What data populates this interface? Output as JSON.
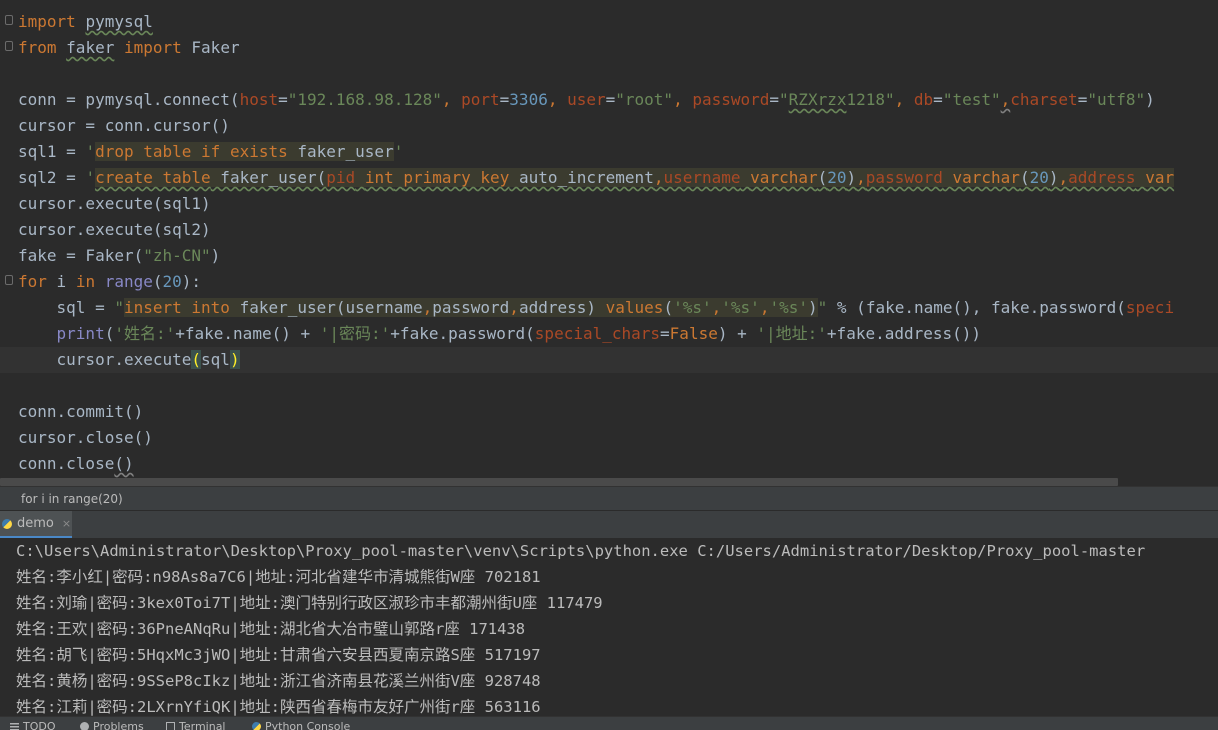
{
  "editor": {
    "lines": [
      [
        "import",
        " ",
        "pymysql"
      ],
      [
        "from",
        " ",
        "faker",
        " ",
        "import",
        " Faker"
      ],
      [
        ""
      ],
      [
        "conn = pymysql.connect(",
        "host",
        "=",
        "\"192.168.98.128\"",
        ", ",
        "port",
        "=",
        "3306",
        ", ",
        "user",
        "=",
        "\"root\"",
        ", ",
        "password",
        "=",
        "\"",
        "RZXrzx",
        "1218\"",
        ", ",
        "db",
        "=",
        "\"test\"",
        ",",
        "charset",
        "=",
        "\"utf8\"",
        ")"
      ],
      [
        "cursor = conn.cursor()"
      ],
      [
        "sql1 = ",
        "'",
        "drop table if exists",
        " faker_user",
        "'"
      ],
      [
        "sql2 = ",
        "'",
        "create table",
        " faker_user(",
        "pid",
        " ",
        "int",
        " ",
        "primary key",
        " auto_increment",
        ",",
        "username",
        " ",
        "varchar",
        "(",
        "20",
        ")",
        ",",
        "password",
        " ",
        "varchar",
        "(",
        "20",
        ")",
        ",",
        "address",
        " ",
        "var"
      ],
      [
        "cursor.execute(sql1)"
      ],
      [
        "cursor.execute(sql2)"
      ],
      [
        "fake = Faker(",
        "\"zh-CN\"",
        ")"
      ],
      [
        "for",
        " i ",
        "in",
        " ",
        "range",
        "(",
        "20",
        "):"
      ],
      [
        "    sql = ",
        "\"",
        "insert into",
        " faker_user(username",
        ",",
        "password",
        ",",
        "address) ",
        "values",
        "(",
        "'",
        "%s",
        "'",
        ",",
        "'",
        "%s",
        "'",
        ",",
        "'",
        "%s",
        "'",
        ")",
        "\"",
        " % (fake.name(), fake.password(",
        "speci"
      ],
      [
        "    ",
        "print",
        "(",
        "'姓名:'",
        "+fake.name() + ",
        "'|密码:'",
        "+fake.password(",
        "special_chars",
        "=",
        "False",
        ") + ",
        "'|地址:'",
        "+fake.address())"
      ],
      [
        "    cursor.execute",
        "(",
        "sql",
        ")"
      ],
      [
        ""
      ],
      [
        "conn.commit()"
      ],
      [
        "cursor.close()"
      ],
      [
        "conn.close",
        "()"
      ]
    ]
  },
  "breadcrumb": {
    "text": "for i in range(20)"
  },
  "run": {
    "tab_label": "demo",
    "close_glyph": "×"
  },
  "console": {
    "lines": [
      "C:\\Users\\Administrator\\Desktop\\Proxy_pool-master\\venv\\Scripts\\python.exe C:/Users/Administrator/Desktop/Proxy_pool-master",
      "姓名:李小红|密码:n98As8a7C6|地址:河北省建华市清城熊街W座 702181",
      "姓名:刘瑜|密码:3kex0Toi7T|地址:澳门特别行政区淑珍市丰都潮州街U座 117479",
      "姓名:王欢|密码:36PneANqRu|地址:湖北省大冶市璧山郭路r座 171438",
      "姓名:胡飞|密码:5HqxMc3jWO|地址:甘肃省六安县西夏南京路S座 517197",
      "姓名:黄杨|密码:9SSeP8cIkz|地址:浙江省济南县花溪兰州街V座 928748",
      "姓名:江莉|密码:2LXrnYfiQK|地址:陕西省春梅市友好广州街r座 563116"
    ]
  },
  "statusbar": {
    "items": [
      "TODO",
      "Problems",
      "Terminal",
      "Python Console"
    ]
  },
  "colors": {
    "keyword": "#cc7832",
    "string": "#6a8759",
    "number": "#6897bb",
    "param": "#aa4926",
    "builtin": "#8888c6",
    "text": "#a9b7c6",
    "background": "#2b2b2b"
  }
}
